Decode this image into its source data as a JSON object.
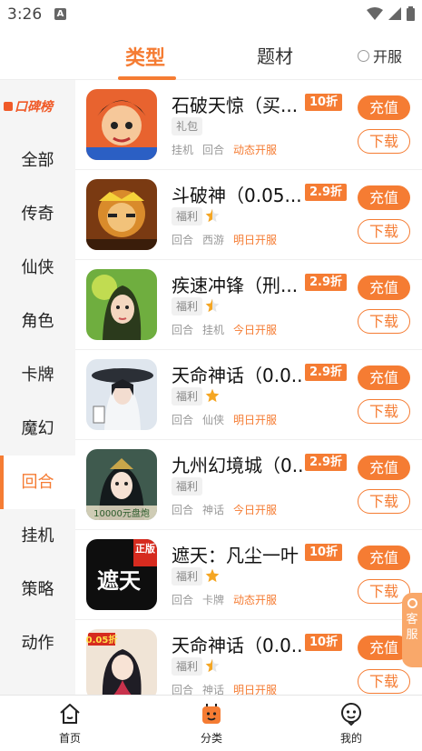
{
  "status": {
    "time": "3:26",
    "notif_letter": "A"
  },
  "tabs": {
    "type": "类型",
    "theme": "题材",
    "kaifu": "开服"
  },
  "sidebar": {
    "logo": "口碑榜",
    "items": [
      "全部",
      "传奇",
      "仙侠",
      "角色",
      "卡牌",
      "魔幻",
      "回合",
      "挂机",
      "策略",
      "动作"
    ],
    "active": "回合"
  },
  "games": [
    {
      "title": "石破天惊（买...",
      "discount": "10折",
      "tag": "礼包",
      "star": "none",
      "meta": [
        "挂机",
        "回合"
      ],
      "open": "动态开服",
      "charge": "充值",
      "download": "下载"
    },
    {
      "title": "斗破神（0.05...",
      "discount": "2.9折",
      "tag": "福利",
      "star": "half",
      "meta": [
        "回合",
        "西游"
      ],
      "open": "明日开服",
      "charge": "充值",
      "download": "下载"
    },
    {
      "title": "疾速冲锋（刑...",
      "discount": "2.9折",
      "tag": "福利",
      "star": "half",
      "meta": [
        "回合",
        "挂机"
      ],
      "open": "今日开服",
      "charge": "充值",
      "download": "下载"
    },
    {
      "title": "天命神话（0.0...",
      "discount": "2.9折",
      "tag": "福利",
      "star": "full",
      "meta": [
        "回合",
        "仙侠"
      ],
      "open": "明日开服",
      "charge": "充值",
      "download": "下载"
    },
    {
      "title": "九州幻境城（0...",
      "discount": "2.9折",
      "tag": "福利",
      "star": "none",
      "meta": [
        "回合",
        "神话"
      ],
      "open": "今日开服",
      "charge": "充值",
      "download": "下载"
    },
    {
      "title": "遮天：凡尘一叶",
      "discount": "10折",
      "tag": "福利",
      "star": "full",
      "meta": [
        "回合",
        "卡牌"
      ],
      "open": "动态开服",
      "charge": "充值",
      "download": "下载"
    },
    {
      "title": "天命神话（0.0...",
      "discount": "10折",
      "tag": "福利",
      "star": "half",
      "meta": [
        "回合",
        "神话"
      ],
      "open": "明日开服",
      "charge": "充值",
      "download": "下载"
    }
  ],
  "icon_texts": {
    "item5": "10000元盘炮",
    "item6_badge": "正版",
    "item6_title": "遮天",
    "item7_badge": "0.05折"
  },
  "service": {
    "label": "客服"
  },
  "bottom_nav": {
    "home": "首页",
    "category": "分类",
    "mine": "我的"
  },
  "colors": {
    "accent": "#f57c33",
    "sidebar_bg": "#f5f5f5"
  }
}
